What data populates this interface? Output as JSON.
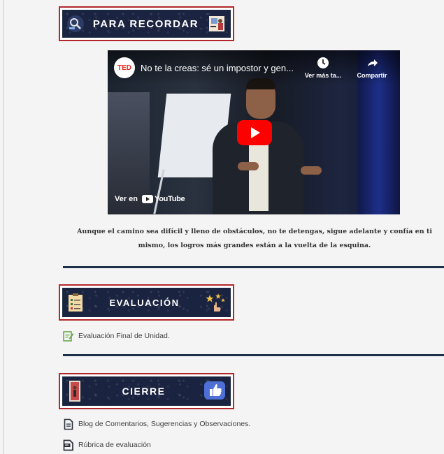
{
  "banners": {
    "recordar": "PARA RECORDAR",
    "evaluacion": "EVALUACIÓN",
    "cierre": "CIERRE"
  },
  "video": {
    "channel_logo": "TED",
    "title": "No te la creas: sé un impostor y gen...",
    "watch_later": "Ver más ta...",
    "share": "Compartir",
    "watch_on": "Ver en",
    "youtube": "YouTube"
  },
  "quote": "Aunque el camino sea difícil y lleno de obstáculos, no te detengas, sigue adelante y confía en ti mismo, los logros más grandes están a la vuelta de la esquina.",
  "links": {
    "evaluacion": "Evaluación Final de Unidad.",
    "blog": "Blog de Comentarios, Sugerencias y Observaciones.",
    "rubrica": "Rúbrica de evaluación"
  },
  "colors": {
    "banner_bg": "#1a2340",
    "frame": "#b3262b",
    "divider": "#1e2f4a",
    "youtube_red": "#ff0000",
    "eval_icon": "#6aa84f"
  },
  "icons": {
    "recordar_left": "magnifier-icon",
    "recordar_right": "teacher-icon",
    "evaluacion_left": "checklist-icon",
    "evaluacion_right": "pointing-hand-stars-icon",
    "cierre_left": "door-exit-icon",
    "cierre_right": "thumbs-up-icon",
    "eval_link": "edit-doc-icon",
    "blog_link": "document-icon",
    "rubrica_link": "rubric-doc-icon"
  }
}
